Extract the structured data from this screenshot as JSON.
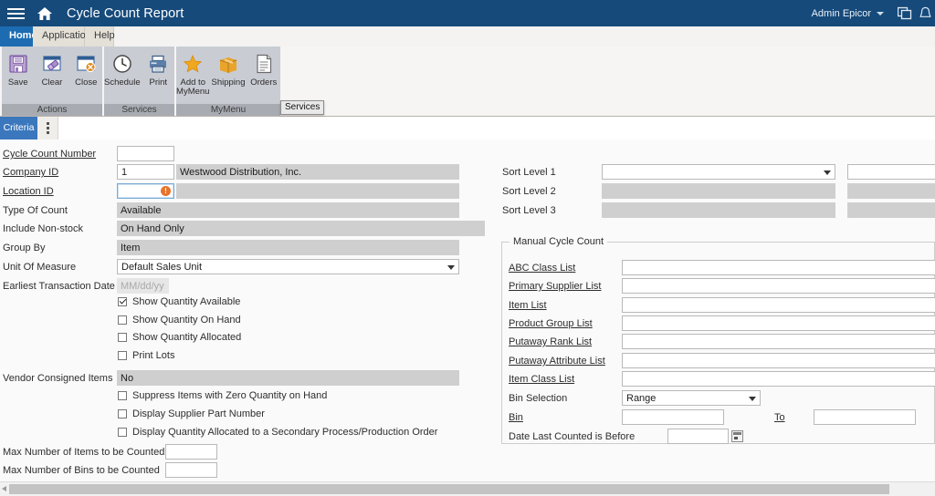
{
  "titlebar": {
    "menu_icon": "hamburger-menu-icon",
    "home_icon": "home-icon",
    "title": "Cycle Count Report",
    "user": "Admin Epicor",
    "windows_icon": "windows-copy-icon",
    "bell_icon": "notification-bell-icon"
  },
  "ribbon": {
    "tabs": [
      {
        "label": "Home",
        "active": true
      },
      {
        "label": "Application",
        "active": false
      },
      {
        "label": "Help",
        "active": false
      }
    ],
    "groups": [
      {
        "title": "Actions",
        "buttons": [
          {
            "label": "Save",
            "icon": "save-disk-icon"
          },
          {
            "label": "Clear",
            "icon": "clear-eraser-icon"
          },
          {
            "label": "Close",
            "icon": "close-window-icon"
          }
        ]
      },
      {
        "title": "Services",
        "buttons": [
          {
            "label": "Schedule",
            "icon": "clock-icon"
          },
          {
            "label": "Print",
            "icon": "printer-icon"
          }
        ]
      },
      {
        "title": "MyMenu",
        "buttons": [
          {
            "label": "Add to\nMyMenu",
            "line1": "Add to",
            "line2": "MyMenu",
            "icon": "star-icon"
          },
          {
            "label": "Shipping",
            "icon": "box-icon"
          },
          {
            "label": "Orders",
            "icon": "document-list-icon"
          }
        ]
      }
    ],
    "tooltip": "Services"
  },
  "sheet": {
    "tab_label": "Criteria",
    "menu_icon": "overflow-dots-icon"
  },
  "form": {
    "left": {
      "cycle_count_number": {
        "label": "Cycle Count Number",
        "value": ""
      },
      "company_id": {
        "label": "Company ID",
        "value": "1",
        "description": "Westwood Distribution, Inc."
      },
      "location_id": {
        "label": "Location ID",
        "value": "",
        "description": "",
        "error_icon": "required-field-error-icon",
        "error_glyph": "!"
      },
      "type_of_count": {
        "label": "Type Of Count",
        "value": "Available"
      },
      "include_nonstock": {
        "label": "Include Non-stock",
        "value": "On Hand Only"
      },
      "group_by": {
        "label": "Group By",
        "value": "Item"
      },
      "unit_of_measure": {
        "label": "Unit Of Measure",
        "value": "Default Sales Unit"
      },
      "earliest_transaction_date": {
        "label": "Earliest Transaction Date",
        "value": "",
        "placeholder": "MM/dd/yy"
      },
      "checkboxes_a": [
        {
          "label": "Show Quantity Available",
          "checked": true
        },
        {
          "label": "Show Quantity On Hand",
          "checked": false
        },
        {
          "label": "Show Quantity Allocated",
          "checked": false
        },
        {
          "label": "Print Lots",
          "checked": false
        }
      ],
      "vendor_consigned_items": {
        "label": "Vendor Consigned Items",
        "value": "No"
      },
      "checkboxes_b": [
        {
          "label": "Suppress Items with Zero Quantity on Hand",
          "checked": false
        },
        {
          "label": "Display Supplier Part Number",
          "checked": false
        },
        {
          "label": "Display Quantity Allocated to a Secondary Process/Production Order",
          "checked": false
        }
      ],
      "max_items": {
        "label": "Max Number of Items to be Counted",
        "value": ""
      },
      "max_bins": {
        "label": "Max Number of Bins to be Counted",
        "value": ""
      }
    },
    "right": {
      "sort_levels": [
        {
          "label": "Sort Level 1",
          "value": "",
          "enabled": true
        },
        {
          "label": "Sort Level 2",
          "value": "",
          "enabled": false
        },
        {
          "label": "Sort Level 3",
          "value": "",
          "enabled": false
        }
      ],
      "manual_cycle_count": {
        "title": "Manual Cycle Count",
        "fields": [
          {
            "label": "ABC Class List",
            "value": "",
            "link": true
          },
          {
            "label": "Primary Supplier List",
            "value": "",
            "link": true
          },
          {
            "label": "Item List",
            "value": "",
            "link": true
          },
          {
            "label": "Product Group List",
            "value": "",
            "link": true
          },
          {
            "label": "Putaway Rank List",
            "value": "",
            "link": true
          },
          {
            "label": "Putaway Attribute List",
            "value": "",
            "link": true
          },
          {
            "label": "Item Class List",
            "value": "",
            "link": true
          }
        ],
        "bin_selection": {
          "label": "Bin Selection",
          "value": "Range"
        },
        "bin": {
          "label": "Bin",
          "value": "",
          "to_label": "To",
          "to_value": ""
        },
        "date_last_counted": {
          "label": "Date Last Counted is Before",
          "value": "",
          "calendar_icon": "calendar-icon"
        }
      }
    }
  },
  "scrollbar": {
    "left_arrow_icon": "scroll-left-arrow-icon"
  },
  "colors": {
    "title_bar": "#164a7b",
    "active_tab": "#1d6cb2",
    "sheet_tab": "#3b77bc",
    "ribbon_group": "#c9ccd3",
    "readonly_field": "#cfcfcf",
    "error": "#e8732a"
  }
}
